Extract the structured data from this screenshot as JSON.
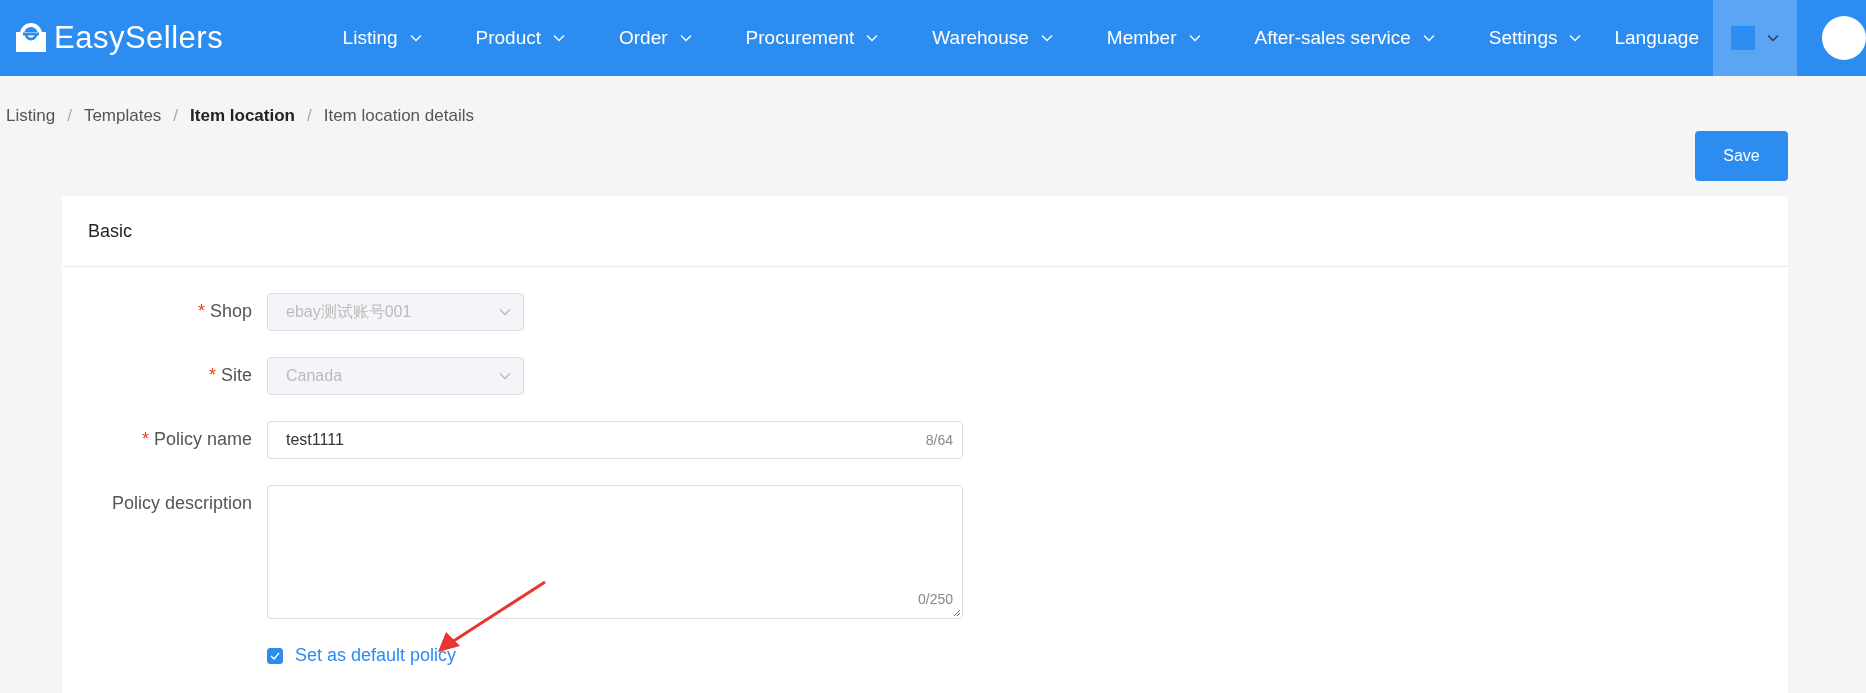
{
  "header": {
    "logo": "EasySellers",
    "nav": [
      {
        "label": "Listing",
        "kind": "menu"
      },
      {
        "label": "Product",
        "kind": "menu"
      },
      {
        "label": "Order",
        "kind": "menu"
      },
      {
        "label": "Procurement",
        "kind": "menu"
      },
      {
        "label": "Warehouse",
        "kind": "menu"
      },
      {
        "label": "Member",
        "kind": "menu"
      },
      {
        "label": "After-sales service",
        "kind": "menu"
      },
      {
        "label": "Settings",
        "kind": "menu"
      },
      {
        "label": "Language",
        "kind": "link"
      }
    ]
  },
  "breadcrumb": [
    {
      "label": "Listing",
      "emphasized": false
    },
    {
      "separator": "/",
      "label": "Templates",
      "emphasized": false
    },
    {
      "separator": "/",
      "label": "Item location",
      "emphasized": true
    },
    {
      "separator": "/",
      "label": "Item location details",
      "emphasized": false
    }
  ],
  "save_button": "Save",
  "card": {
    "title": "Basic",
    "fields": [
      {
        "kind": "select",
        "required_mark": "*",
        "label": "Shop",
        "value": "ebay测试账号001",
        "disabled": true
      },
      {
        "kind": "select",
        "required_mark": "*",
        "label": "Site",
        "value": "Canada",
        "disabled": true
      },
      {
        "kind": "input",
        "required_mark": "*",
        "label": "Policy name",
        "value": "test1111",
        "count": "8/64"
      },
      {
        "kind": "textarea",
        "label": "Policy description",
        "count": "0/250"
      }
    ],
    "default_checkbox": {
      "label": "Set as default policy",
      "checked": true
    }
  }
}
